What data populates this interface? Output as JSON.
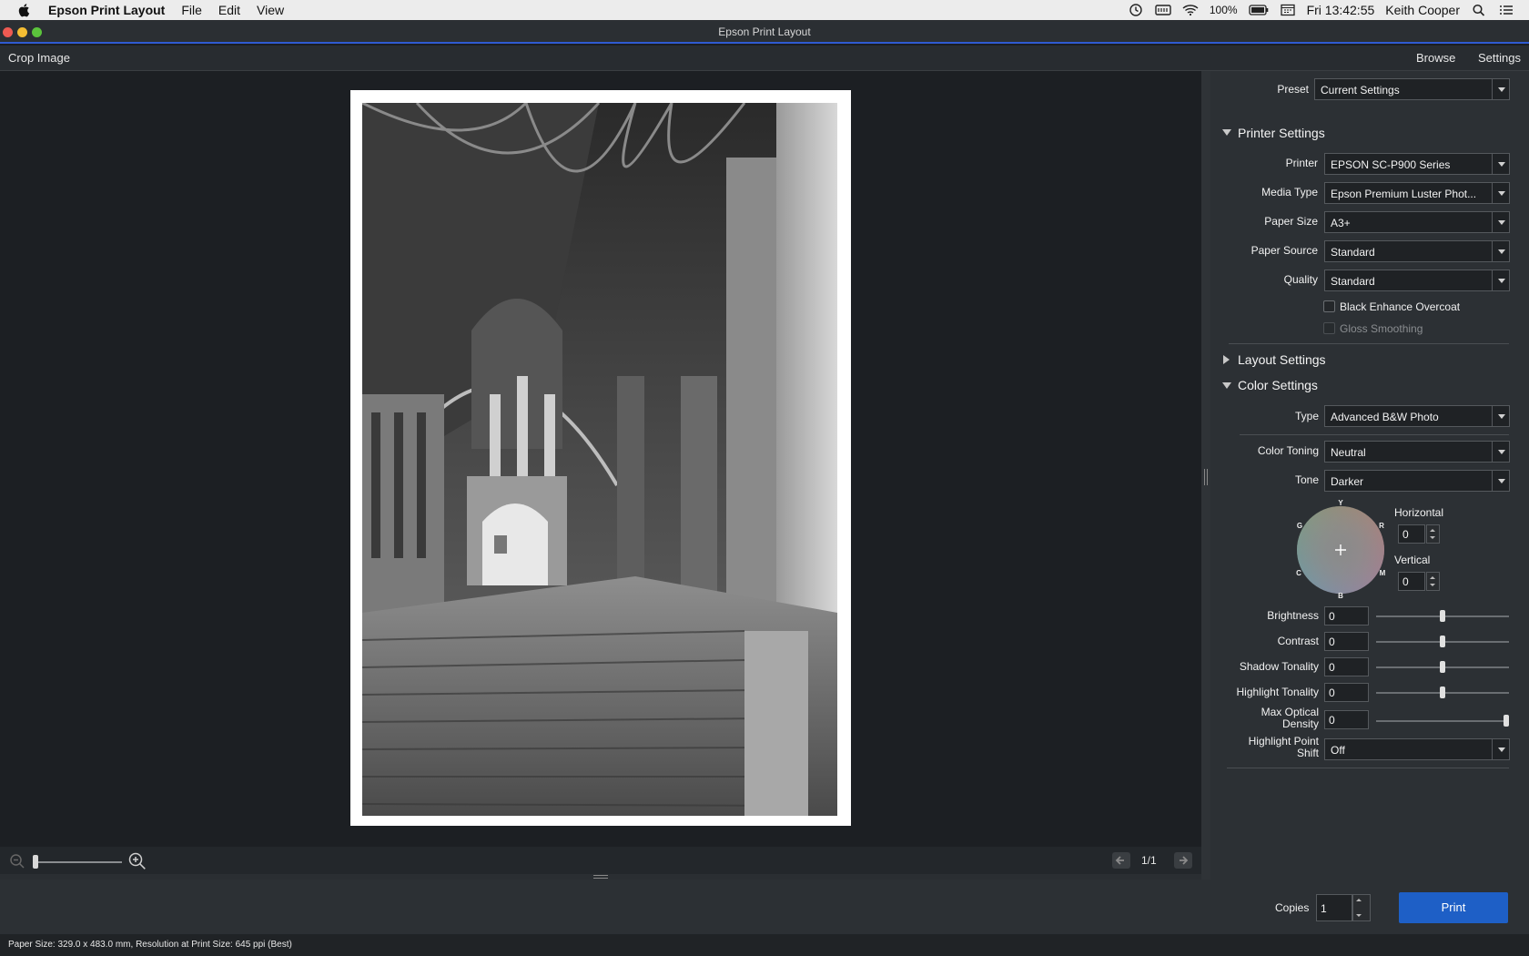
{
  "menubar": {
    "app_name": "Epson Print Layout",
    "menus": [
      "File",
      "Edit",
      "View"
    ],
    "battery": "100%",
    "clock": "Fri 13:42:55",
    "user": "Keith Cooper"
  },
  "window": {
    "title": "Epson Print Layout"
  },
  "toolbar": {
    "crop_label": "Crop Image",
    "browse_label": "Browse",
    "settings_label": "Settings"
  },
  "canvas": {
    "page_indicator": "1/1",
    "zoom_level": 0.0
  },
  "panel": {
    "preset": {
      "label": "Preset",
      "value": "Current Settings"
    },
    "printer_settings": {
      "title": "Printer Settings",
      "printer": {
        "label": "Printer",
        "value": "EPSON SC-P900 Series"
      },
      "media_type": {
        "label": "Media Type",
        "value": "Epson Premium Luster Phot..."
      },
      "paper_size": {
        "label": "Paper Size",
        "value": "A3+"
      },
      "paper_source": {
        "label": "Paper Source",
        "value": "Standard"
      },
      "quality": {
        "label": "Quality",
        "value": "Standard"
      },
      "black_enhance": {
        "label": "Black Enhance Overcoat",
        "checked": false
      },
      "gloss_smoothing": {
        "label": "Gloss Smoothing",
        "checked": false,
        "disabled": true
      }
    },
    "layout_settings": {
      "title": "Layout Settings"
    },
    "color_settings": {
      "title": "Color Settings",
      "type": {
        "label": "Type",
        "value": "Advanced B&W Photo"
      },
      "color_toning": {
        "label": "Color Toning",
        "value": "Neutral"
      },
      "tone": {
        "label": "Tone",
        "value": "Darker"
      },
      "wheel_labels": {
        "y": "Y",
        "r": "R",
        "m": "M",
        "b": "B",
        "c": "C",
        "g": "G"
      },
      "horizontal": {
        "label": "Horizontal",
        "value": "0"
      },
      "vertical": {
        "label": "Vertical",
        "value": "0"
      },
      "brightness": {
        "label": "Brightness",
        "value": "0",
        "level": 0.5
      },
      "contrast": {
        "label": "Contrast",
        "value": "0",
        "level": 0.5
      },
      "shadow_tonality": {
        "label": "Shadow Tonality",
        "value": "0",
        "level": 0.5
      },
      "highlight_tonality": {
        "label": "Highlight Tonality",
        "value": "0",
        "level": 0.5
      },
      "max_optical_density": {
        "label_line1": "Max Optical",
        "label_line2": "Density",
        "value": "0",
        "level": 1.0
      },
      "highlight_point_shift": {
        "label_line1": "Highlight Point",
        "label_line2": "Shift",
        "value": "Off"
      }
    },
    "copies": {
      "label": "Copies",
      "value": "1"
    },
    "print_label": "Print"
  },
  "status": {
    "text": "Paper Size: 329.0 x 483.0 mm,   Resolution at Print Size: 645 ppi (Best)"
  },
  "colors": {
    "accent": "#1e5fc6",
    "title_underline": "#2f5bd1"
  }
}
